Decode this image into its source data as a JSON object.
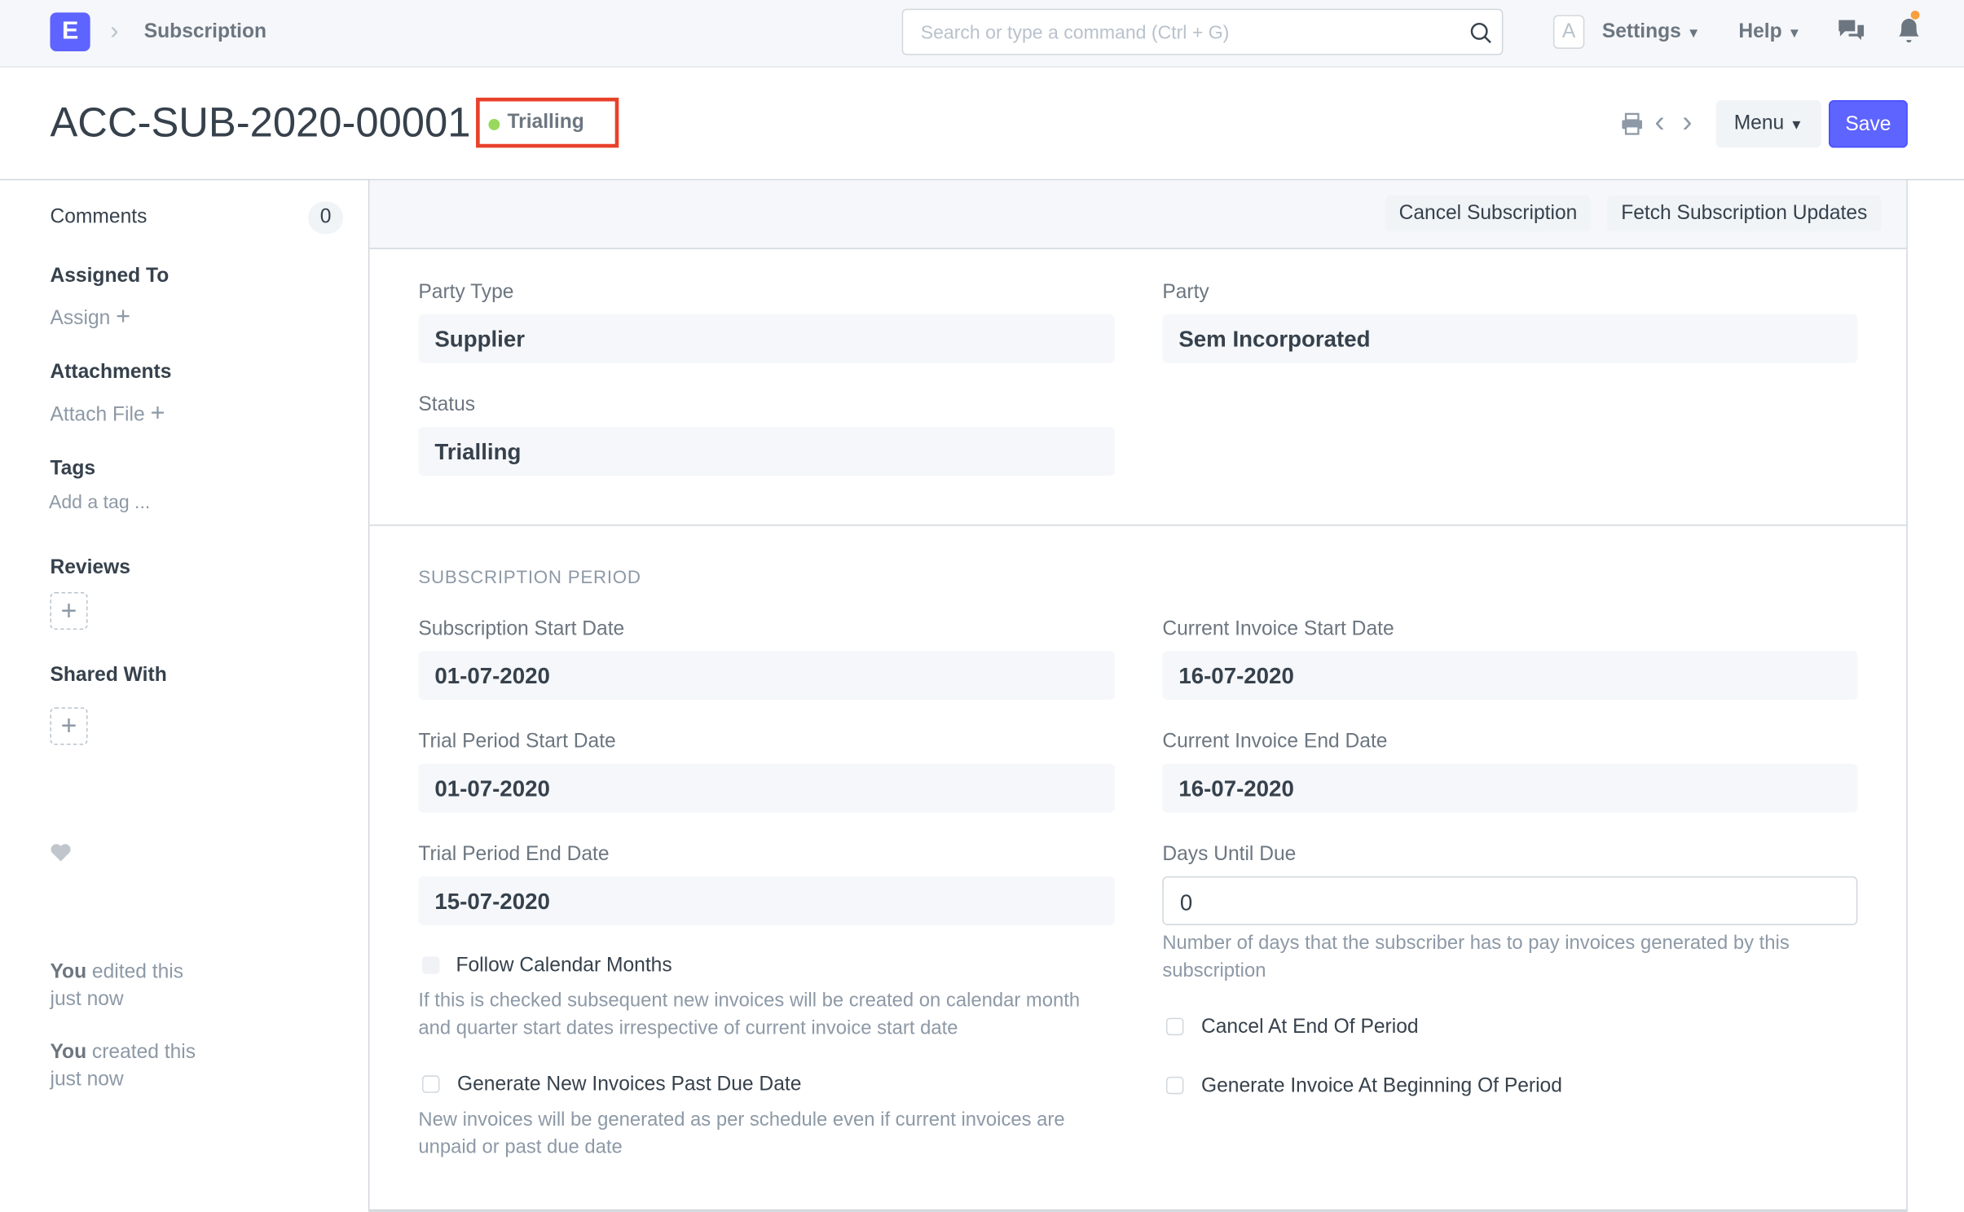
{
  "navbar": {
    "logo": "E",
    "breadcrumb": "Subscription",
    "search_placeholder": "Search or type a command (Ctrl + G)",
    "avatar": "A",
    "settings": "Settings",
    "help": "Help"
  },
  "header": {
    "title": "ACC-SUB-2020-00001",
    "status": "Trialling",
    "menu": "Menu",
    "save": "Save"
  },
  "sidebar": {
    "comments": "Comments",
    "comments_count": "0",
    "assigned_to": "Assigned To",
    "assign": "Assign",
    "attachments": "Attachments",
    "attach_file": "Attach File",
    "tags": "Tags",
    "add_tag": "Add a tag ...",
    "reviews": "Reviews",
    "shared_with": "Shared With",
    "activity": [
      {
        "who": "You",
        "what": " edited this",
        "when": "just now"
      },
      {
        "who": "You",
        "what": " created this",
        "when": "just now"
      }
    ]
  },
  "toolbar": {
    "cancel": "Cancel Subscription",
    "fetch": "Fetch Subscription Updates"
  },
  "form": {
    "party_type_label": "Party Type",
    "party_type": "Supplier",
    "party_label": "Party",
    "party": "Sem Incorporated",
    "status_label": "Status",
    "status": "Trialling",
    "section": "SUBSCRIPTION PERIOD",
    "sub_start_label": "Subscription Start Date",
    "sub_start": "01-07-2020",
    "trial_start_label": "Trial Period Start Date",
    "trial_start": "01-07-2020",
    "trial_end_label": "Trial Period End Date",
    "trial_end": "15-07-2020",
    "cur_start_label": "Current Invoice Start Date",
    "cur_start": "16-07-2020",
    "cur_end_label": "Current Invoice End Date",
    "cur_end": "16-07-2020",
    "days_label": "Days Until Due",
    "days": "0",
    "days_desc": "Number of days that the subscriber has to pay invoices generated by this subscription",
    "follow_cal": "Follow Calendar Months",
    "follow_cal_desc": "If this is checked subsequent new invoices will be created on calendar month and quarter start dates irrespective of current invoice start date",
    "gen_past_due": "Generate New Invoices Past Due Date",
    "gen_past_due_desc": "New invoices will be generated as per schedule even if current invoices are unpaid or past due date",
    "cancel_end": "Cancel At End Of Period",
    "gen_begin": "Generate Invoice At Beginning Of Period"
  }
}
